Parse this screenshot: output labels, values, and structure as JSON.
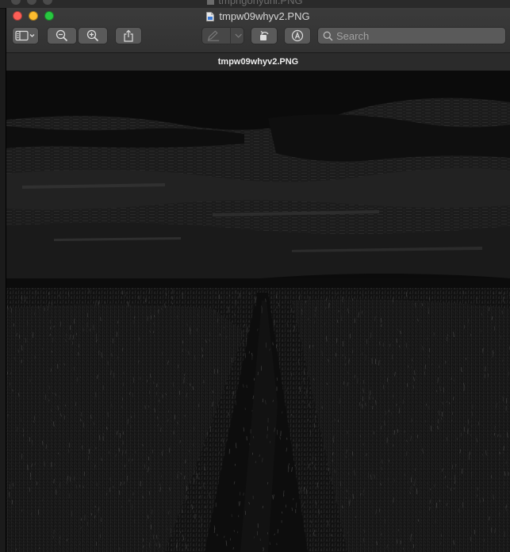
{
  "background_window": {
    "title": "tmpngohyuhi.PNG"
  },
  "window": {
    "title": "tmpw09whyv2.PNG",
    "tab_title": "tmpw09whyv2.PNG",
    "traffic_light_colors": {
      "close": "#fe5f57",
      "minimize": "#febc2e",
      "zoom": "#28c840"
    }
  },
  "toolbar": {
    "buttons": [
      {
        "name": "sidebar-toggle-button",
        "icon": "sidebar-icon"
      },
      {
        "name": "zoom-out-button",
        "icon": "zoom-out-icon"
      },
      {
        "name": "zoom-in-button",
        "icon": "zoom-in-icon"
      },
      {
        "name": "share-button",
        "icon": "share-icon"
      },
      {
        "name": "markup-pen-button",
        "icon": "pen-icon"
      },
      {
        "name": "rotate-button",
        "icon": "rotate-icon"
      },
      {
        "name": "annotate-button",
        "icon": "markup-circle-icon"
      }
    ],
    "search": {
      "placeholder": "Search",
      "value": ""
    }
  },
  "document": {
    "content": "dark edge-detected landscape photo: sky with clouds, horizon, grass-lined path"
  }
}
